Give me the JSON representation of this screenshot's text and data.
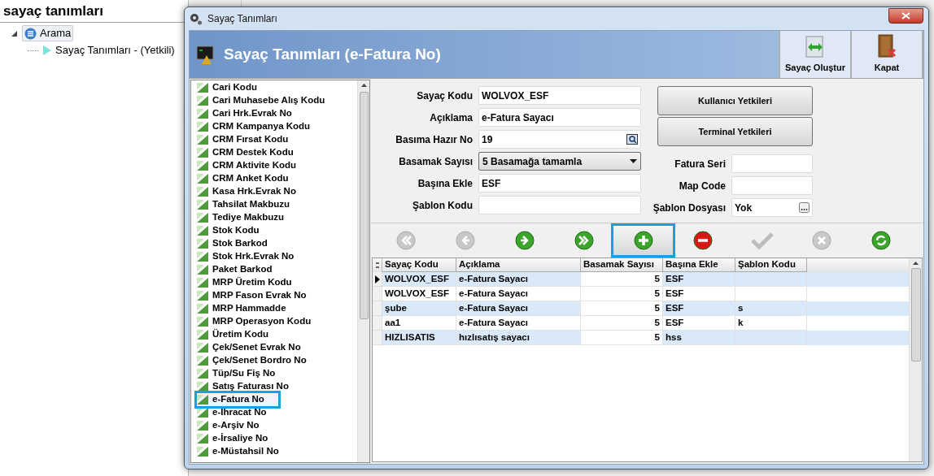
{
  "page_title": "sayaç tanımları",
  "tree": [
    {
      "label": "Arama",
      "expanded": true,
      "selected": true,
      "children": [
        {
          "label": "Sayaç Tanımları - (Yetkili)"
        }
      ]
    }
  ],
  "dialog": {
    "title": "Sayaç Tanımları",
    "header": "Sayaç Tanımları (e-Fatura No)",
    "toolbar": [
      {
        "kind": "create",
        "label": "Sayaç Oluştur"
      },
      {
        "kind": "close",
        "label": "Kapat"
      }
    ],
    "list": [
      {
        "label": "Cari Kodu",
        "selected": false
      },
      {
        "label": "Cari Muhasebe Alış Kodu",
        "selected": false
      },
      {
        "label": "Cari Hrk.Evrak No",
        "selected": false
      },
      {
        "label": "CRM Kampanya Kodu",
        "selected": false
      },
      {
        "label": "CRM Fırsat Kodu",
        "selected": false
      },
      {
        "label": "CRM Destek Kodu",
        "selected": false
      },
      {
        "label": "CRM Aktivite Kodu",
        "selected": false
      },
      {
        "label": "CRM Anket Kodu",
        "selected": false
      },
      {
        "label": "Kasa Hrk.Evrak No",
        "selected": false
      },
      {
        "label": "Tahsilat Makbuzu",
        "selected": false
      },
      {
        "label": "Tediye Makbuzu",
        "selected": false
      },
      {
        "label": "Stok Kodu",
        "selected": false
      },
      {
        "label": "Stok Barkod",
        "selected": false
      },
      {
        "label": "Stok Hrk.Evrak No",
        "selected": false
      },
      {
        "label": "Paket Barkod",
        "selected": false
      },
      {
        "label": "MRP Üretim Kodu",
        "selected": false
      },
      {
        "label": "MRP Fason Evrak No",
        "selected": false
      },
      {
        "label": "MRP Hammadde",
        "selected": false
      },
      {
        "label": "MRP Operasyon Kodu",
        "selected": false
      },
      {
        "label": "Üretim Kodu",
        "selected": false
      },
      {
        "label": "Çek/Senet Evrak No",
        "selected": false
      },
      {
        "label": "Çek/Senet Bordro No",
        "selected": false
      },
      {
        "label": "Tüp/Su Fiş No",
        "selected": false
      },
      {
        "label": "Satış Faturası No",
        "selected": false
      },
      {
        "label": "e-Fatura No",
        "selected": true
      },
      {
        "label": "e-İhracat No",
        "selected": false
      },
      {
        "label": "e-Arşiv No",
        "selected": false
      },
      {
        "label": "e-İrsaliye No",
        "selected": false
      },
      {
        "label": "e-Müstahsil No",
        "selected": false
      }
    ],
    "form_left": [
      {
        "kind": "text",
        "label": "Sayaç Kodu",
        "value": "WOLVOX_ESF"
      },
      {
        "kind": "text",
        "label": "Açıklama",
        "value": "e-Fatura Sayacı"
      },
      {
        "kind": "lookup",
        "label": "Basıma Hazır No",
        "value": "19"
      },
      {
        "kind": "select",
        "label": "Basamak Sayısı",
        "value": "5 Basamağa tamamla"
      },
      {
        "kind": "text",
        "label": "Başına Ekle",
        "value": "ESF"
      },
      {
        "kind": "text",
        "label": "Şablon Kodu"
      }
    ],
    "buttons": [
      "Kullanıcı Yetkileri",
      "Terminal Yetkileri"
    ],
    "form_right": [
      {
        "kind": "text",
        "label": "Fatura Seri"
      },
      {
        "kind": "text",
        "label": "Map Code"
      },
      {
        "kind": "browse",
        "label": "Şablon Dosyası",
        "value": "Yok"
      }
    ],
    "navigator": [
      {
        "kind": "first",
        "disabled": true,
        "highlighted": false
      },
      {
        "kind": "prev",
        "disabled": true,
        "highlighted": false
      },
      {
        "kind": "next",
        "disabled": false,
        "highlighted": false
      },
      {
        "kind": "last",
        "disabled": false,
        "highlighted": false
      },
      {
        "kind": "add",
        "disabled": false,
        "highlighted": true
      },
      {
        "kind": "delete",
        "disabled": false,
        "highlighted": false
      },
      {
        "kind": "post",
        "disabled": true,
        "highlighted": false
      },
      {
        "kind": "cancel",
        "disabled": true,
        "highlighted": false
      },
      {
        "kind": "refresh",
        "disabled": false,
        "highlighted": false
      }
    ],
    "grid": {
      "columns": [
        "Sayaç Kodu",
        "Açıklama",
        "Basamak Sayısı",
        "Başına Ekle",
        "Şablon Kodu"
      ],
      "rows": [
        {
          "current": true,
          "cells": [
            "WOLVOX_ESF",
            "e-Fatura Sayacı",
            "5",
            "ESF",
            ""
          ]
        },
        {
          "current": false,
          "cells": [
            "WOLVOX_ESF",
            "e-Fatura Sayacı",
            "5",
            "ESF",
            ""
          ]
        },
        {
          "current": false,
          "cells": [
            "şube",
            "e-Fatura Sayacı",
            "5",
            "ESF",
            "s"
          ]
        },
        {
          "current": false,
          "cells": [
            "aa1",
            "e-Fatura Sayacı",
            "5",
            "ESF",
            "k"
          ]
        },
        {
          "current": false,
          "cells": [
            "HIZLISATIS",
            "hızlısatış sayacı",
            "5",
            "hss",
            ""
          ]
        }
      ]
    }
  }
}
